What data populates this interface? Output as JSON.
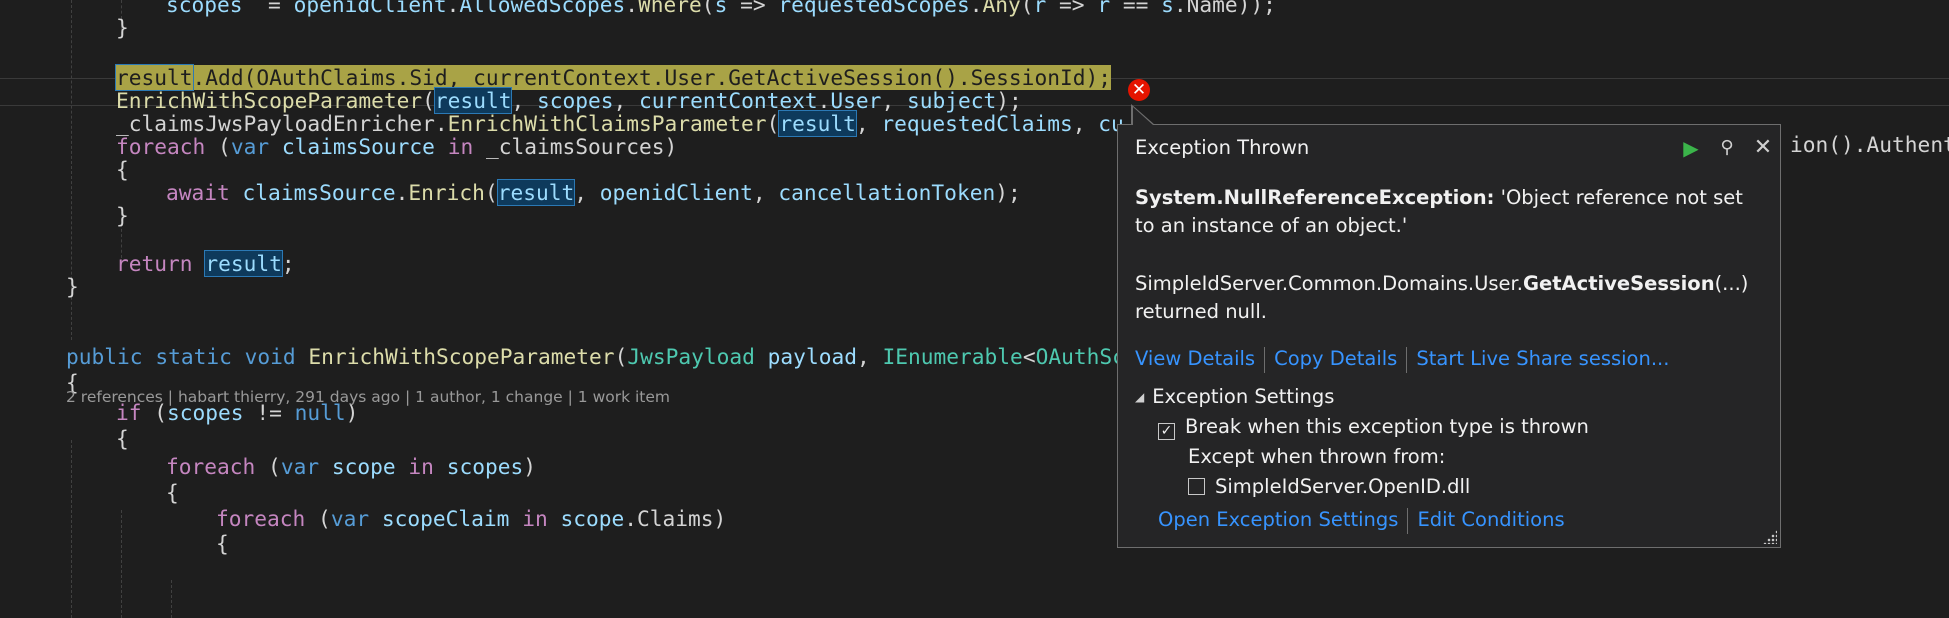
{
  "editor": {
    "lines": [
      {
        "segments": [
          [
            "va",
            "scopes"
          ],
          [
            "",
            "  = "
          ],
          [
            "va",
            "openidClient"
          ],
          [
            "",
            "."
          ],
          [
            "va",
            "AllowedScopes"
          ],
          [
            "",
            "."
          ],
          [
            "fn",
            "Where"
          ],
          [
            "",
            "("
          ],
          [
            "va",
            "s"
          ],
          [
            "",
            " => "
          ],
          [
            "va",
            "requestedScopes"
          ],
          [
            "",
            "."
          ],
          [
            "fn",
            "Any"
          ],
          [
            "",
            "("
          ],
          [
            "va",
            "r"
          ],
          [
            "",
            " => "
          ],
          [
            "va",
            "r"
          ],
          [
            "",
            " == "
          ],
          [
            "va",
            "s"
          ],
          [
            "",
            ".Name));"
          ]
        ]
      },
      {
        "segments": [
          [
            "",
            "}"
          ]
        ]
      },
      {
        "segments": []
      },
      {
        "segments": [
          [
            "exline hl",
            "result"
          ],
          [
            "exline",
            ".Add(OAuthClaims.Sid, currentContext.User.GetActiveSession().SessionId);"
          ]
        ]
      },
      {
        "segments": [
          [
            "fn",
            "EnrichWithScopeParameter"
          ],
          [
            "",
            "("
          ],
          [
            "va hl",
            "result"
          ],
          [
            ", ",
            ", "
          ],
          [
            "va",
            "scopes"
          ],
          [
            "",
            ", "
          ],
          [
            "va",
            "currentContext"
          ],
          [
            "",
            "."
          ],
          [
            "va",
            "User"
          ],
          [
            "",
            ", "
          ],
          [
            "va",
            "subject"
          ],
          [
            "",
            ");"
          ]
        ]
      },
      {
        "segments": [
          [
            "",
            "_claimsJwsPayloadEnricher."
          ],
          [
            "fn",
            "EnrichWithClaimsParameter"
          ],
          [
            "",
            "("
          ],
          [
            "va hl",
            "result"
          ],
          [
            "",
            ", "
          ],
          [
            "va",
            "requestedClaims"
          ],
          [
            "",
            ", "
          ],
          [
            "va",
            "cu"
          ]
        ]
      },
      {
        "segments": [
          [
            "ctl",
            "foreach"
          ],
          [
            "",
            " ("
          ],
          [
            "kw",
            "var"
          ],
          [
            "",
            " "
          ],
          [
            "va",
            "claimsSource"
          ],
          [
            "",
            " "
          ],
          [
            "ctl",
            "in"
          ],
          [
            "",
            " _claimsSources)"
          ]
        ]
      },
      {
        "segments": [
          [
            "",
            "{"
          ]
        ]
      },
      {
        "segments": [
          [
            "ctl",
            "await"
          ],
          [
            "",
            " "
          ],
          [
            "va",
            "claimsSource"
          ],
          [
            "",
            "."
          ],
          [
            "fn",
            "Enrich"
          ],
          [
            "",
            "("
          ],
          [
            "va hl",
            "result"
          ],
          [
            "",
            ", "
          ],
          [
            "va",
            "openidClient"
          ],
          [
            "",
            ", "
          ],
          [
            "va",
            "cancellationToken"
          ],
          [
            "",
            ");"
          ]
        ]
      },
      {
        "segments": [
          [
            "",
            "}"
          ]
        ]
      },
      {
        "segments": []
      },
      {
        "segments": [
          [
            "ctl",
            "return"
          ],
          [
            "",
            " "
          ],
          [
            "va hl",
            "result"
          ],
          [
            "",
            ";"
          ]
        ]
      },
      {
        "segments": [
          [
            "",
            "}"
          ]
        ]
      },
      {
        "segments": []
      },
      {
        "segments": [
          [
            "kw",
            "public"
          ],
          [
            "",
            " "
          ],
          [
            "kw",
            "static"
          ],
          [
            "",
            " "
          ],
          [
            "kw",
            "void"
          ],
          [
            "",
            " "
          ],
          [
            "fn",
            "EnrichWithScopeParameter"
          ],
          [
            "",
            "("
          ],
          [
            "ty",
            "JwsPayload"
          ],
          [
            "",
            " "
          ],
          [
            "va",
            "payload"
          ],
          [
            "",
            ", "
          ],
          [
            "ty",
            "IEnumerable"
          ],
          [
            "",
            "<"
          ],
          [
            "ty",
            "OAuthSc"
          ]
        ]
      },
      {
        "segments": [
          [
            "",
            "{"
          ]
        ]
      },
      {
        "segments": [
          [
            "ctl",
            "if"
          ],
          [
            "",
            " ("
          ],
          [
            "va",
            "scopes"
          ],
          [
            "",
            " != "
          ],
          [
            "kw",
            "null"
          ],
          [
            "",
            ")"
          ]
        ]
      },
      {
        "segments": [
          [
            "",
            "{"
          ]
        ]
      },
      {
        "segments": [
          [
            "ctl",
            "foreach"
          ],
          [
            "",
            " ("
          ],
          [
            "kw",
            "var"
          ],
          [
            "",
            " "
          ],
          [
            "va",
            "scope"
          ],
          [
            "",
            " "
          ],
          [
            "ctl",
            "in"
          ],
          [
            "",
            " "
          ],
          [
            "va",
            "scopes"
          ],
          [
            "",
            ")"
          ]
        ]
      },
      {
        "segments": [
          [
            "",
            "{"
          ]
        ]
      },
      {
        "segments": [
          [
            "ctl",
            "foreach"
          ],
          [
            "",
            " ("
          ],
          [
            "kw",
            "var"
          ],
          [
            "",
            " "
          ],
          [
            "va",
            "scopeClaim"
          ],
          [
            "",
            " "
          ],
          [
            "ctl",
            "in"
          ],
          [
            "",
            " "
          ],
          [
            "va",
            "scope"
          ],
          [
            "",
            ".Claims)"
          ]
        ]
      },
      {
        "segments": [
          [
            "",
            "{"
          ]
        ]
      }
    ],
    "right_overflow_text": "ion().Authenti",
    "codelens": "2 references | habart thierry, 291 days ago | 1 author, 1 change | 1 work item"
  },
  "error_icon": "error-x-icon",
  "popup": {
    "title": "Exception Thrown",
    "exception_type": "System.NullReferenceException:",
    "exception_message": " 'Object reference not set to an instance of an object.'",
    "returned_prefix": "SimpleIdServer.Common.Domains.User.",
    "returned_method": "GetActiveSession",
    "returned_suffix": "(...) returned null.",
    "links": {
      "view_details": "View Details",
      "copy_details": "Copy Details",
      "live_share": "Start Live Share session..."
    },
    "settings": {
      "header": "Exception Settings",
      "break_label": "Break when this exception type is thrown",
      "break_checked": true,
      "except_label": "Except when thrown from:",
      "module_label": "SimpleIdServer.OpenID.dll",
      "module_checked": false,
      "open_settings": "Open Exception Settings",
      "edit_conditions": "Edit Conditions"
    }
  }
}
